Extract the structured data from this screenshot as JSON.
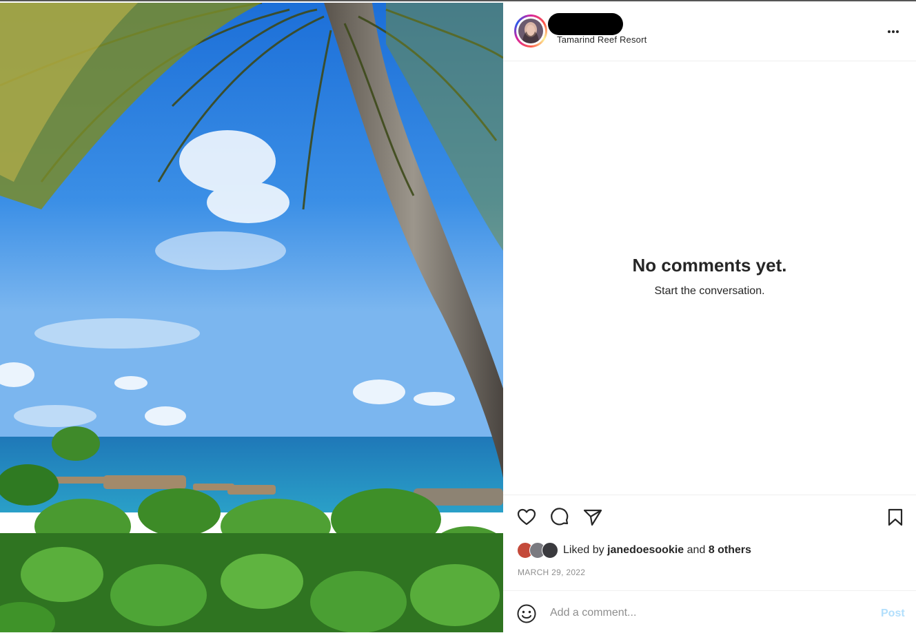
{
  "post": {
    "location": "Tamarind Reef Resort",
    "more_icon": "more-horizontal-icon"
  },
  "comments": {
    "empty_title": "No comments yet.",
    "empty_subtitle": "Start the conversation."
  },
  "actions": {
    "icons": [
      "heart-icon",
      "comment-icon",
      "share-icon",
      "bookmark-icon"
    ],
    "liked_prefix": "Liked by",
    "liked_user": "janedoesookie",
    "liked_and": "and",
    "liked_others": "8 others",
    "date": "MARCH 29, 2022"
  },
  "comment_box": {
    "placeholder": "Add a comment...",
    "post_label": "Post"
  },
  "colors": {
    "post_disabled": "#b2dffc",
    "muted_text": "#8e8e8e",
    "primary_text": "#262626"
  }
}
